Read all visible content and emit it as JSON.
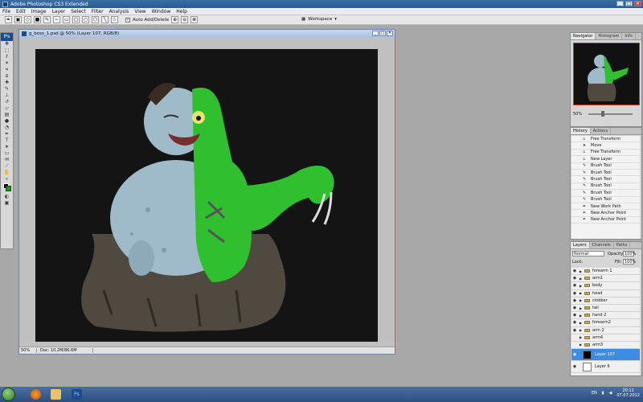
{
  "window": {
    "title": "Adobe Photoshop CS3 Extended"
  },
  "menu": [
    "File",
    "Edit",
    "Image",
    "Layer",
    "Select",
    "Filter",
    "Analysis",
    "View",
    "Window",
    "Help"
  ],
  "options_bar": {
    "auto_add_delete_label": "Auto Add/Delete",
    "auto_add_delete_checked": true,
    "workspace_label": "Workspace"
  },
  "tools": {
    "logo": "Ps",
    "foreground_color": "#000000",
    "background_color": "#1a9c1a"
  },
  "document": {
    "title": "g_boss_1.psd @ 50% (Layer 107, RGB/8)",
    "zoom": "50%",
    "doc_info": "Doc: 10.2M/86.6M"
  },
  "navigator": {
    "tabs": [
      "Navigator",
      "Histogram",
      "Info"
    ],
    "zoom": "50%"
  },
  "history": {
    "tabs": [
      "History",
      "Actions"
    ],
    "items": [
      {
        "label": "Free Transform",
        "icon": "transform-icon"
      },
      {
        "label": "Move",
        "icon": "move-icon"
      },
      {
        "label": "Free Transform",
        "icon": "transform-icon"
      },
      {
        "label": "New Layer",
        "icon": "layer-icon"
      },
      {
        "label": "Brush Tool",
        "icon": "brush-icon"
      },
      {
        "label": "Brush Tool",
        "icon": "brush-icon"
      },
      {
        "label": "Brush Tool",
        "icon": "brush-icon"
      },
      {
        "label": "Brush Tool",
        "icon": "brush-icon"
      },
      {
        "label": "Brush Tool",
        "icon": "brush-icon"
      },
      {
        "label": "Brush Tool",
        "icon": "brush-icon"
      },
      {
        "label": "New Work Path",
        "icon": "pen-icon"
      },
      {
        "label": "New Anchor Point",
        "icon": "pen-icon"
      },
      {
        "label": "New Anchor Point",
        "icon": "pen-icon"
      }
    ]
  },
  "layers": {
    "tabs": [
      "Layers",
      "Channels",
      "Paths"
    ],
    "blend_mode": "Normal",
    "opacity_label": "Opacity:",
    "opacity": "100%",
    "lock_label": "Lock:",
    "fill_label": "Fill:",
    "fill": "100%",
    "groups": [
      "forearm 1",
      "arm1",
      "body",
      "head",
      "clobber",
      "tail",
      "hand 2",
      "forearm2",
      "arm 2",
      "arm4",
      "arm3"
    ],
    "layer_107": "Layer 107",
    "layer_6": "Layer 6"
  },
  "taskbar": {
    "language": "EN",
    "time": "20:11",
    "date": "07.07.2012"
  }
}
